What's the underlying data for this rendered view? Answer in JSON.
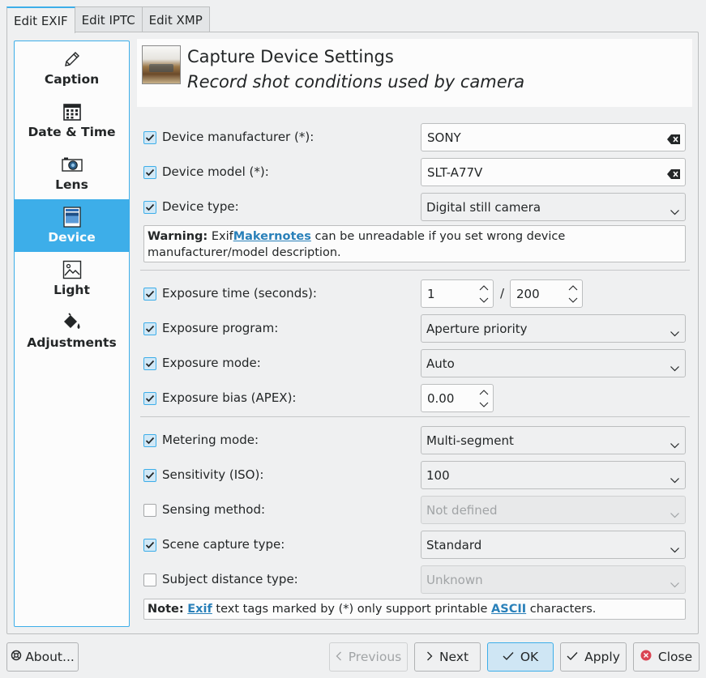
{
  "tabs": [
    "Edit EXIF",
    "Edit IPTC",
    "Edit XMP"
  ],
  "sidebar": [
    {
      "label": "Caption",
      "icon": "pencil-icon"
    },
    {
      "label": "Date & Time",
      "icon": "calendar-icon"
    },
    {
      "label": "Lens",
      "icon": "camera-icon"
    },
    {
      "label": "Device",
      "icon": "device-icon"
    },
    {
      "label": "Light",
      "icon": "image-icon"
    },
    {
      "label": "Adjustments",
      "icon": "paint-bucket-icon"
    }
  ],
  "header": {
    "title": "Capture Device Settings",
    "subtitle": "Record shot conditions used by camera"
  },
  "fields": {
    "manufacturer": {
      "label": "Device manufacturer (*):",
      "value": "SONY",
      "checked": true
    },
    "model": {
      "label": "Device model (*):",
      "value": "SLT-A77V",
      "checked": true
    },
    "type": {
      "label": "Device type:",
      "value": "Digital still camera",
      "checked": true
    },
    "exposure_time": {
      "label": "Exposure time (seconds):",
      "num": "1",
      "slash": "/",
      "den": "200",
      "checked": true
    },
    "exposure_program": {
      "label": "Exposure program:",
      "value": "Aperture priority",
      "checked": true
    },
    "exposure_mode": {
      "label": "Exposure mode:",
      "value": "Auto",
      "checked": true
    },
    "exposure_bias": {
      "label": "Exposure bias (APEX):",
      "value": "0.00",
      "checked": true
    },
    "metering_mode": {
      "label": "Metering mode:",
      "value": "Multi-segment",
      "checked": true
    },
    "sensitivity": {
      "label": "Sensitivity (ISO):",
      "value": "100",
      "checked": true
    },
    "sensing_method": {
      "label": "Sensing method:",
      "value": "Not defined",
      "checked": false
    },
    "scene_capture": {
      "label": "Scene capture type:",
      "value": "Standard",
      "checked": true
    },
    "subject_distance": {
      "label": "Subject distance type:",
      "value": "Unknown",
      "checked": false
    }
  },
  "warning": {
    "bold": "Warning:",
    "pre": " Exif",
    "link": "Makernotes",
    "post": " can be unreadable if you set wrong device manufacturer/model description."
  },
  "note": {
    "bold": "Note:",
    "link1": "Exif",
    "mid": " text tags marked by (*) only support printable ",
    "link2": "ASCII",
    "post": " characters."
  },
  "buttons": {
    "about": "About...",
    "previous": "Previous",
    "next": "Next",
    "ok": "OK",
    "apply": "Apply",
    "close": "Close"
  },
  "colors": {
    "accent": "#3daee9",
    "link": "#2980b9",
    "close_icon": "#da4453"
  }
}
